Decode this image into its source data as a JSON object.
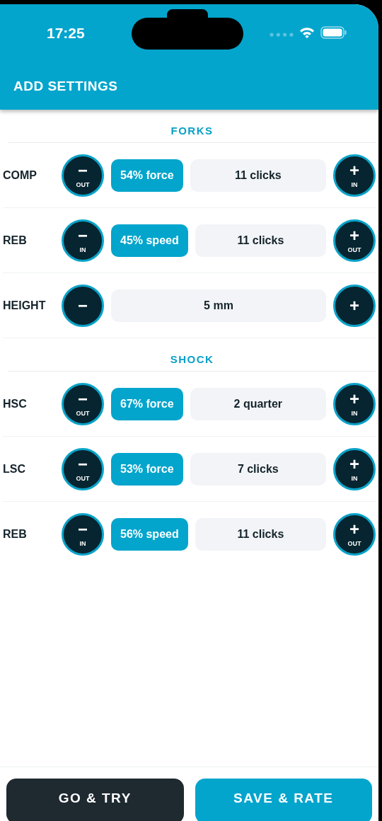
{
  "status_bar": {
    "time": "17:25"
  },
  "header": {
    "title": "ADD SETTINGS"
  },
  "sections": [
    {
      "title": "FORKS",
      "rows": [
        {
          "kind": "adjust",
          "label": "COMP",
          "minus": {
            "symbol": "−",
            "sub": "OUT"
          },
          "badge": "54% force",
          "value": "11 clicks",
          "plus": {
            "symbol": "+",
            "sub": "IN"
          }
        },
        {
          "kind": "adjust",
          "label": "REB",
          "minus": {
            "symbol": "−",
            "sub": "IN"
          },
          "badge": "45% speed",
          "value": "11 clicks",
          "plus": {
            "symbol": "+",
            "sub": "OUT"
          }
        },
        {
          "kind": "plain",
          "label": "HEIGHT",
          "minus": {
            "symbol": "−"
          },
          "value": "5 mm",
          "plus": {
            "symbol": "+"
          }
        }
      ]
    },
    {
      "title": "SHOCK",
      "rows": [
        {
          "kind": "adjust",
          "label": "HSC",
          "minus": {
            "symbol": "−",
            "sub": "OUT"
          },
          "badge": "67% force",
          "value": "2 quarter",
          "plus": {
            "symbol": "+",
            "sub": "IN"
          }
        },
        {
          "kind": "adjust",
          "label": "LSC",
          "minus": {
            "symbol": "−",
            "sub": "OUT"
          },
          "badge": "53% force",
          "value": "7 clicks",
          "plus": {
            "symbol": "+",
            "sub": "IN"
          }
        },
        {
          "kind": "adjust",
          "label": "REB",
          "minus": {
            "symbol": "−",
            "sub": "IN"
          },
          "badge": "56% speed",
          "value": "11 clicks",
          "plus": {
            "symbol": "+",
            "sub": "OUT"
          }
        }
      ]
    }
  ],
  "buttons": [
    {
      "kind": "dark",
      "label": "GO & TRY"
    },
    {
      "kind": "primary",
      "label": "SAVE & RATE"
    }
  ]
}
